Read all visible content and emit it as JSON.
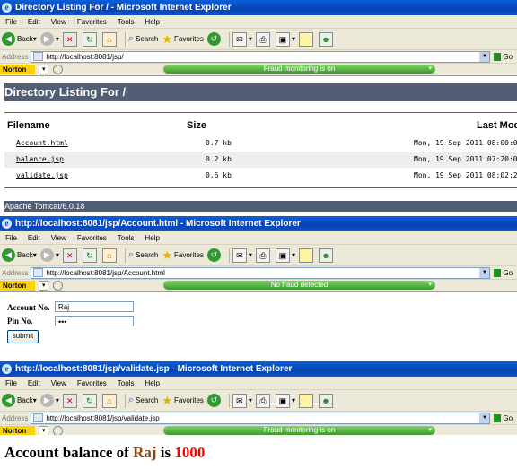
{
  "window1": {
    "title": "Directory Listing For / - Microsoft Internet Explorer",
    "address": "http://localhost:8081/jsp/",
    "fraud_status": "Fraud monitoring is on",
    "heading": "Directory Listing For /",
    "columns": {
      "filename": "Filename",
      "size": "Size",
      "modified": "Last Mod"
    },
    "files": [
      {
        "name": "Account.html",
        "size": "0.7 kb",
        "date": "Mon, 19 Sep 2011 08:00:0"
      },
      {
        "name": "balance.jsp",
        "size": "0.2 kb",
        "date": "Mon, 19 Sep 2011 07:20:0"
      },
      {
        "name": "validate.jsp",
        "size": "0.6 kb",
        "date": "Mon, 19 Sep 2011 08:02:2"
      }
    ],
    "server": "Apache Tomcat/6.0.18"
  },
  "window2": {
    "title": "http://localhost:8081/jsp/Account.html - Microsoft Internet Explorer",
    "address": "http://localhost:8081/jsp/Account.html",
    "fraud_status": "No fraud detected",
    "account_label": "Account No.",
    "account_value": "Raj",
    "pin_label": "Pin No.",
    "pin_value": "•••",
    "submit_label": "submit"
  },
  "window3": {
    "title": "http://localhost:8081/jsp/validate.jsp - Microsoft Internet Explorer",
    "address": "http://localhost:8081/jsp/validate.jsp",
    "fraud_status": "Fraud monitoring is on",
    "result_prefix": "Account balance of",
    "result_name": "Raj",
    "result_is": "is",
    "result_amount": "1000"
  },
  "chrome": {
    "menu": [
      "File",
      "Edit",
      "View",
      "Favorites",
      "Tools",
      "Help"
    ],
    "back": "Back",
    "search": "Search",
    "favorites": "Favorites",
    "address_label": "Address",
    "go": "Go",
    "norton": "Norton"
  },
  "colors": {
    "tomcat_bar": "#525d76",
    "result_name": "#8b4513",
    "result_amount": "#ff0000"
  }
}
